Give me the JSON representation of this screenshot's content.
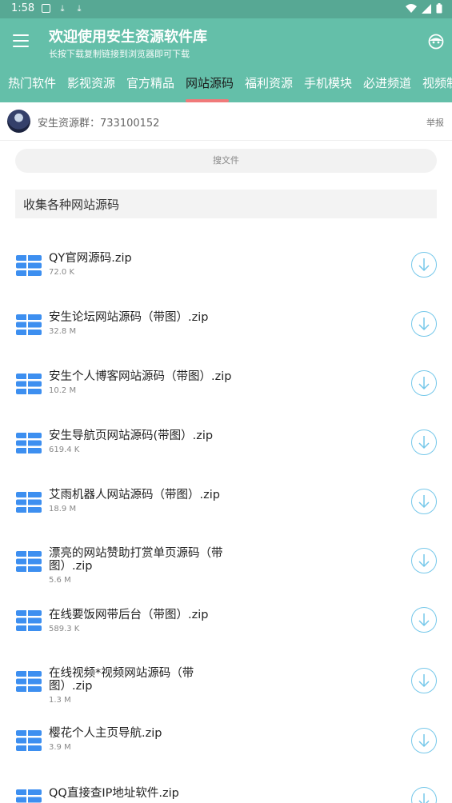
{
  "status_bar": {
    "time": "1:58"
  },
  "app_bar": {
    "title": "欢迎使用安生资源软件库",
    "subtitle": "长按下载复制链接到浏览器即可下载"
  },
  "tabs": [
    {
      "label": "热门软件"
    },
    {
      "label": "影视资源"
    },
    {
      "label": "官方精品"
    },
    {
      "label": "网站源码",
      "active": true
    },
    {
      "label": "福利资源"
    },
    {
      "label": "手机模块"
    },
    {
      "label": "必进频道"
    },
    {
      "label": "视频制"
    }
  ],
  "group": {
    "label": "安生资源群：733100152",
    "report": "举报"
  },
  "search": {
    "placeholder": "搜文件"
  },
  "description": "收集各种网站源码",
  "files": [
    {
      "name": "QY官网源码.zip",
      "size": "72.0 K"
    },
    {
      "name": "安生论坛网站源码（带图）.zip",
      "size": "32.8 M"
    },
    {
      "name": "安生个人博客网站源码（带图）.zip",
      "size": "10.2 M"
    },
    {
      "name": "安生导航页网站源码(带图）.zip",
      "size": "619.4 K"
    },
    {
      "name": "艾雨机器人网站源码（带图）.zip",
      "size": "18.9 M"
    },
    {
      "name": "漂亮的网站赞助打赏单页源码（带图）.zip",
      "size": "5.6 M"
    },
    {
      "name": "在线要饭网带后台（带图）.zip",
      "size": "589.3 K"
    },
    {
      "name": "在线视频*视频网站源码（带图）.zip",
      "size": "1.3 M"
    },
    {
      "name": "樱花个人主页导航.zip",
      "size": "3.9 M"
    },
    {
      "name": "QQ直接查IP地址软件.zip",
      "size": ""
    }
  ],
  "colors": {
    "primary": "#64bfa9",
    "status_bar": "#57a894",
    "indicator": "#f07a7a",
    "file_icon": "#3d8ff0",
    "download": "#76c8ea"
  },
  "icons": {
    "menu": "menu-icon",
    "profile": "face-icon",
    "file": "zip-file-icon",
    "download": "download-icon"
  }
}
